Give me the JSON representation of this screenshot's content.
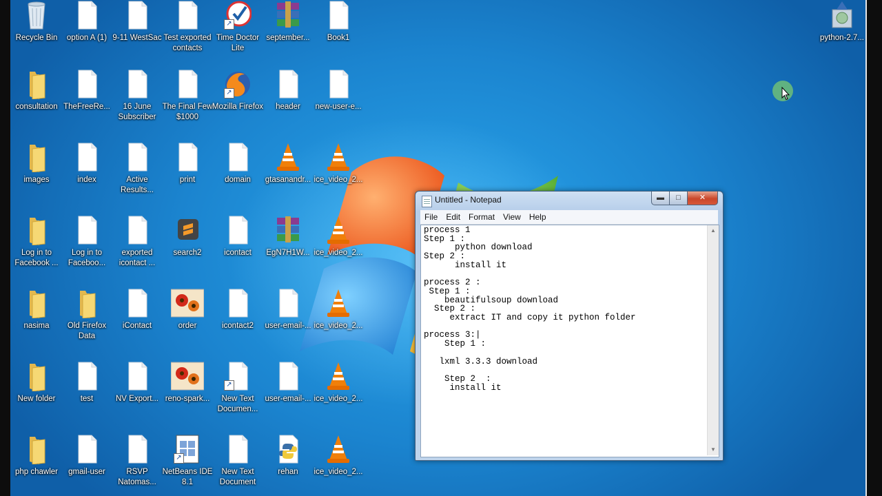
{
  "desktop": {
    "icons": [
      {
        "label": "Recycle Bin",
        "type": "recycle-bin"
      },
      {
        "label": "option A (1)",
        "type": "document"
      },
      {
        "label": "9-11 WestSac",
        "type": "document"
      },
      {
        "label": "Test exported contacts",
        "type": "document"
      },
      {
        "label": "Time Doctor Lite",
        "type": "time-doctor",
        "shortcut": true
      },
      {
        "label": "september...",
        "type": "winrar"
      },
      {
        "label": "Book1",
        "type": "document"
      },
      {
        "label": "python-2.7...",
        "type": "installer"
      },
      {
        "label": "consultation",
        "type": "folder"
      },
      {
        "label": "TheFreeRe...",
        "type": "document"
      },
      {
        "label": "16 June Subscriber",
        "type": "document"
      },
      {
        "label": "The Final Few $1000",
        "type": "document"
      },
      {
        "label": "Mozilla Firefox",
        "type": "firefox",
        "shortcut": true
      },
      {
        "label": "header",
        "type": "document"
      },
      {
        "label": "new-user-e...",
        "type": "document"
      },
      {
        "label": "images",
        "type": "folder"
      },
      {
        "label": "index",
        "type": "document"
      },
      {
        "label": "Active Results...",
        "type": "document"
      },
      {
        "label": "print",
        "type": "document"
      },
      {
        "label": "domain",
        "type": "document"
      },
      {
        "label": "gtasanandr...",
        "type": "vlc"
      },
      {
        "label": "ice_video_2...",
        "type": "vlc"
      },
      {
        "label": "Log in to Facebook ...",
        "type": "folder"
      },
      {
        "label": "Log in to Faceboo...",
        "type": "document"
      },
      {
        "label": "exported icontact ...",
        "type": "document"
      },
      {
        "label": "search2",
        "type": "sublime"
      },
      {
        "label": "icontact",
        "type": "document"
      },
      {
        "label": "EgN7H1W...",
        "type": "winrar"
      },
      {
        "label": "ice_video_2...",
        "type": "vlc"
      },
      {
        "label": "nasima",
        "type": "folder"
      },
      {
        "label": "Old Firefox Data",
        "type": "folder"
      },
      {
        "label": "iContact",
        "type": "document"
      },
      {
        "label": "order",
        "type": "flower"
      },
      {
        "label": "icontact2",
        "type": "document"
      },
      {
        "label": "user-email-...",
        "type": "document"
      },
      {
        "label": "ice_video_2...",
        "type": "vlc"
      },
      {
        "label": "New folder",
        "type": "folder"
      },
      {
        "label": "test",
        "type": "document"
      },
      {
        "label": "NV Export...",
        "type": "document"
      },
      {
        "label": "reno-spark...",
        "type": "flower"
      },
      {
        "label": "New Text Documen...",
        "type": "document",
        "shortcut": true
      },
      {
        "label": "user-email-...",
        "type": "document"
      },
      {
        "label": "ice_video_2...",
        "type": "vlc"
      },
      {
        "label": "php chawler",
        "type": "folder"
      },
      {
        "label": "gmail-user",
        "type": "document"
      },
      {
        "label": "RSVP Natomas...",
        "type": "document"
      },
      {
        "label": "NetBeans IDE 8.1",
        "type": "netbeans",
        "shortcut": true
      },
      {
        "label": "New Text Document",
        "type": "document"
      },
      {
        "label": "rehan",
        "type": "python"
      },
      {
        "label": "ice_video_2...",
        "type": "vlc"
      }
    ]
  },
  "notepad": {
    "title": "Untitled - Notepad",
    "menu": [
      "File",
      "Edit",
      "Format",
      "View",
      "Help"
    ],
    "content": "process 1\nStep 1 :\n      python download\nStep 2 :\n      install it\n\nprocess 2 :\n Step 1 :\n    beautifulsoup download\n  Step 2 :\n     extract IT and copy it python folder\n\nprocess 3:|\n    Step 1 :\n\n   lxml 3.3.3 download\n\n    Step 2  :\n     install it",
    "buttons": {
      "minimize": "▬",
      "maximize": "□",
      "close": "✕"
    }
  },
  "colors": {
    "desktop": "#1d8fd6",
    "accent": "#c9472a"
  }
}
